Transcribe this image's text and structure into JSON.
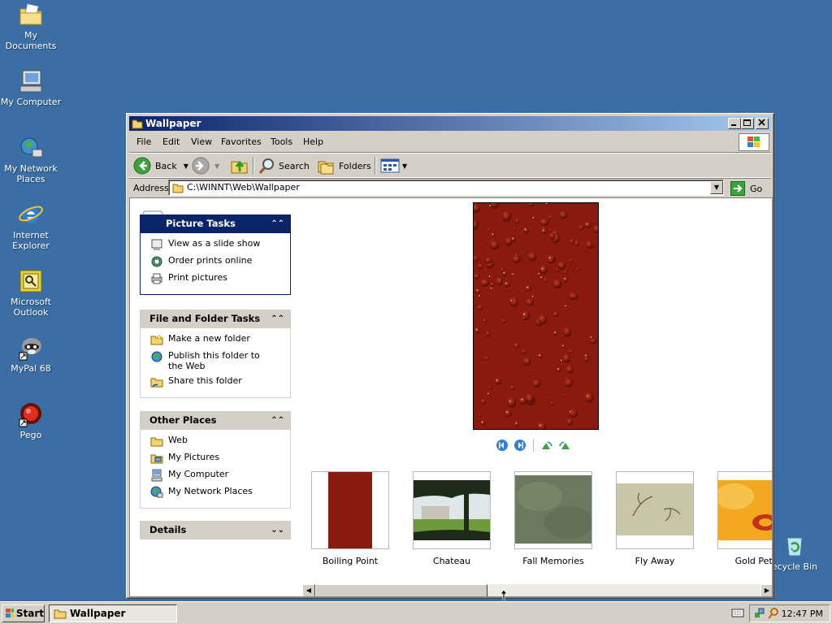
{
  "desktop": {
    "icons": [
      {
        "label": "My Documents"
      },
      {
        "label": "My Computer"
      },
      {
        "label": "My Network Places"
      },
      {
        "label": "Internet Explorer"
      },
      {
        "label": "Microsoft Outlook"
      },
      {
        "label": "MyPal 68"
      },
      {
        "label": "Pego"
      },
      {
        "label": "ecycle Bin"
      }
    ]
  },
  "window": {
    "title": "Wallpaper",
    "menus": [
      "File",
      "Edit",
      "View",
      "Favorites",
      "Tools",
      "Help"
    ],
    "toolbar": {
      "back": "Back",
      "search": "Search",
      "folders": "Folders"
    },
    "address": {
      "label": "Address",
      "value": "C:\\WINNT\\Web\\Wallpaper",
      "go": "Go"
    }
  },
  "taskpane": {
    "picture_tasks": {
      "title": "Picture Tasks",
      "items": [
        "View as a slide show",
        "Order prints online",
        "Print pictures"
      ]
    },
    "file_folder_tasks": {
      "title": "File and Folder Tasks",
      "items": [
        "Make a new folder",
        "Publish this folder to the Web",
        "Share this folder"
      ]
    },
    "other_places": {
      "title": "Other Places",
      "items": [
        "Web",
        "My Pictures",
        "My Computer",
        "My Network Places"
      ]
    },
    "details": {
      "title": "Details"
    }
  },
  "thumbnails": [
    {
      "label": "Boiling Point",
      "color": "#8b1a0e"
    },
    {
      "label": "Chateau",
      "color": "#4a6b3a"
    },
    {
      "label": "Fall Memories",
      "color": "#6b7a5e"
    },
    {
      "label": "Fly Away",
      "color": "#c9c6a8"
    },
    {
      "label": "Gold Peta",
      "color": "#f3a81f"
    }
  ],
  "taskbar": {
    "start": "Start",
    "active_task": "Wallpaper",
    "clock": "12:47 PM"
  },
  "colors": {
    "desktop": "#3a6ea5",
    "titlebar_start": "#0a246a",
    "titlebar_end": "#a6caf0",
    "picture_red": "#8b1a0e"
  }
}
